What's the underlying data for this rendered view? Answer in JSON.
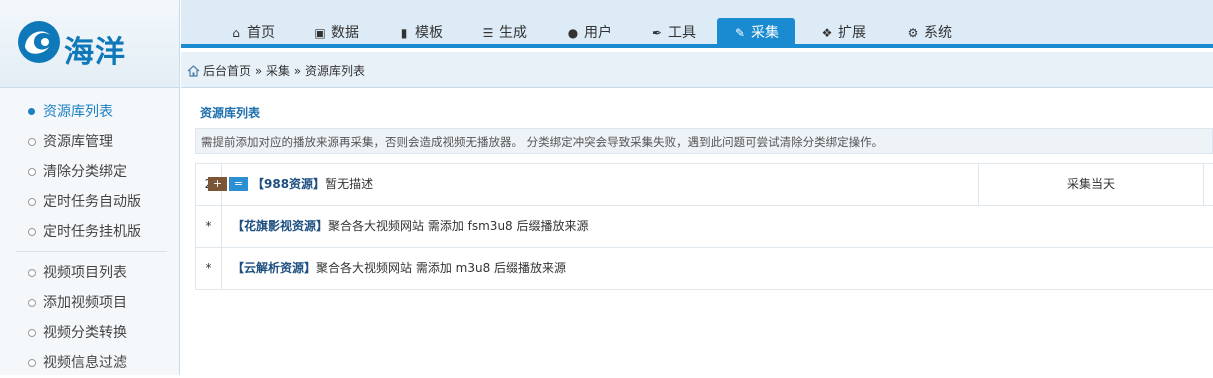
{
  "brand": {
    "name": "海洋"
  },
  "nav": {
    "items": [
      {
        "label": "首页",
        "icon": "home-icon"
      },
      {
        "label": "数据",
        "icon": "database-icon"
      },
      {
        "label": "模板",
        "icon": "file-icon"
      },
      {
        "label": "生成",
        "icon": "server-icon"
      },
      {
        "label": "用户",
        "icon": "user-icon"
      },
      {
        "label": "工具",
        "icon": "wrench-icon"
      },
      {
        "label": "采集",
        "icon": "edit-icon",
        "active": true
      },
      {
        "label": "扩展",
        "icon": "puzzle-icon"
      },
      {
        "label": "系统",
        "icon": "gear-icon"
      }
    ]
  },
  "breadcrumb": {
    "text": "后台首页 » 采集 » 资源库列表"
  },
  "sidebar": {
    "items": [
      {
        "label": "资源库列表",
        "active": true
      },
      {
        "label": "资源库管理"
      },
      {
        "label": "清除分类绑定"
      },
      {
        "label": "定时任务自动版"
      },
      {
        "label": "定时任务挂机版"
      },
      {
        "label": "视频项目列表"
      },
      {
        "label": "添加视频项目"
      },
      {
        "label": "视频分类转换"
      },
      {
        "label": "视频信息过滤"
      }
    ]
  },
  "main": {
    "title": "资源库列表",
    "notice": "需提前添加对应的播放来源再采集，否则会造成视频无播放器。    分类绑定冲突会导致采集失败，遇到此问题可尝试清除分类绑定操作。",
    "rows": [
      {
        "num": "2",
        "plus": "+",
        "eq": "=",
        "name": "【988资源】",
        "desc": "暂无描述",
        "action": "采集当天"
      },
      {
        "num": "*",
        "name": "【花旗影视资源】",
        "desc": "聚合各大视频网站 需添加 fsm3u8 后缀播放来源"
      },
      {
        "num": "*",
        "name": "【云解析资源】",
        "desc": "聚合各大视频网站 需添加 m3u8 后缀播放来源"
      }
    ]
  },
  "colors": {
    "accent": "#1a8ad1",
    "link": "#1d4f80",
    "plus_btn": "#7a5637"
  }
}
